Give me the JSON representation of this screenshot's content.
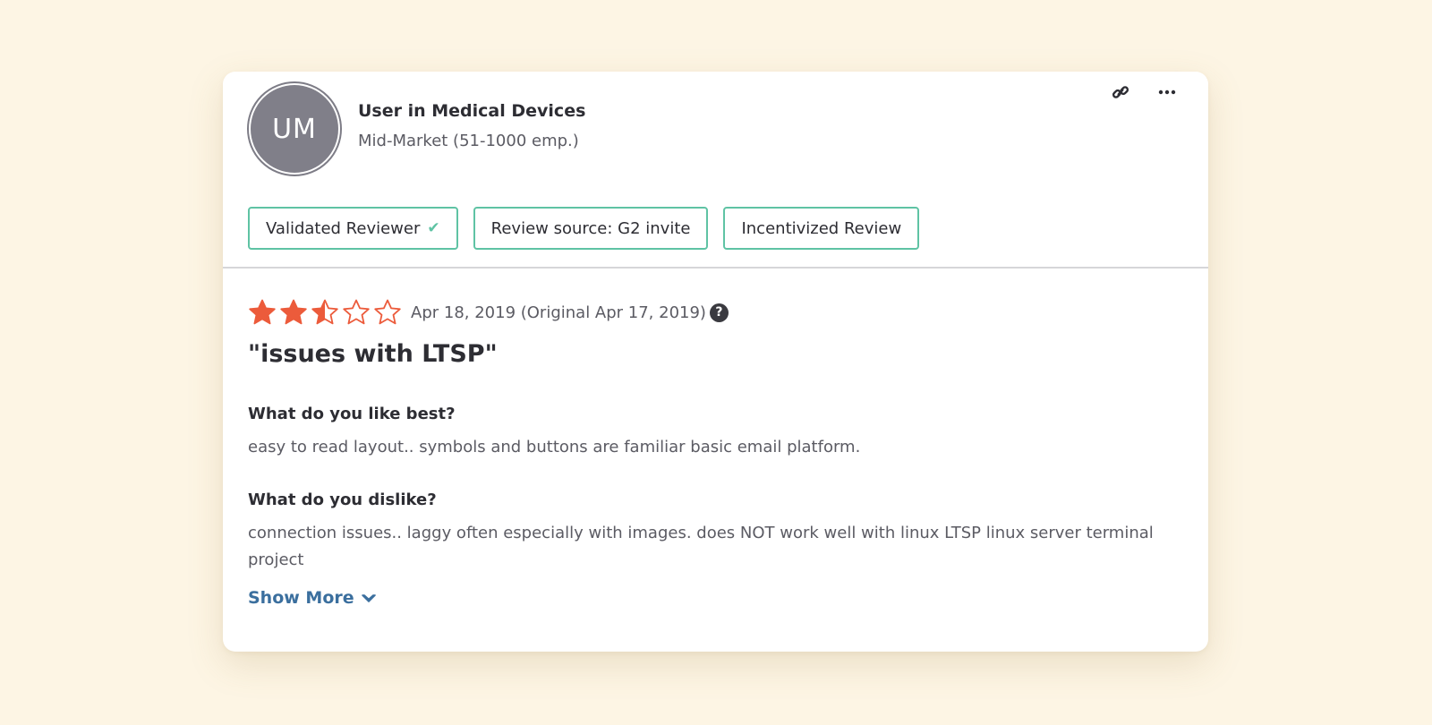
{
  "reviewer": {
    "initials": "UM",
    "name": "User in Medical Devices",
    "segment": "Mid-Market (51-1000 emp.)"
  },
  "badges": [
    {
      "label": "Validated Reviewer",
      "icon": "check-icon"
    },
    {
      "label": "Review source: G2 invite"
    },
    {
      "label": "Incentivized Review"
    }
  ],
  "review": {
    "rating": 2.5,
    "rating_max": 5,
    "date": "Apr 18, 2019 (Original Apr 17, 2019)",
    "title": "\"issues with LTSP\"",
    "questions": [
      {
        "heading": "What do you like best?",
        "answer": "easy to read layout.. symbols and buttons are familiar basic email platform."
      },
      {
        "heading": "What do you dislike?",
        "answer": "connection issues.. laggy often especially with images. does NOT work well with linux LTSP linux server terminal project"
      }
    ],
    "show_more_label": "Show More"
  },
  "colors": {
    "background": "#fdf5e4",
    "star": "#ec5b3b",
    "badge_border": "#5fc3a4",
    "link": "#3b6f9e",
    "avatar": "#807f89"
  },
  "icons": {
    "link": "link-icon",
    "more": "more-options-icon",
    "help": "question-circle-icon",
    "show_more": "chevron-down-icon"
  }
}
